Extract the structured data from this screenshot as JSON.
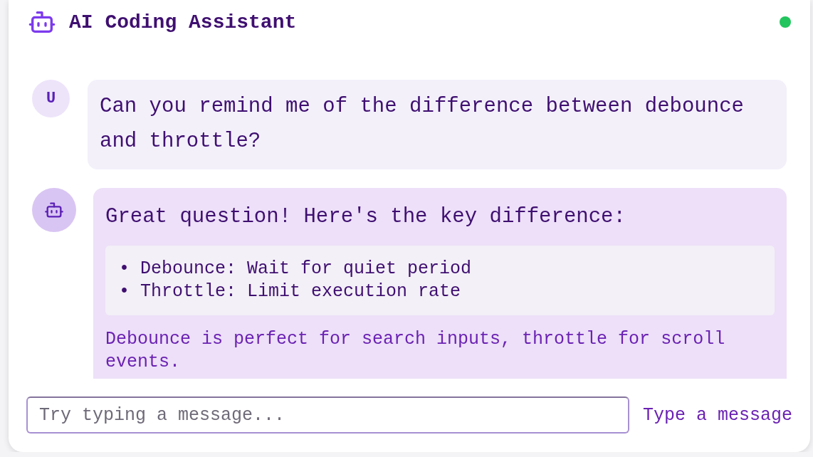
{
  "header": {
    "title": "AI Coding Assistant",
    "online": true
  },
  "messages": [
    {
      "kind": "user",
      "avatar": "U",
      "text": "Can you remind me of the difference between debounce and throttle?"
    },
    {
      "kind": "assistant",
      "text": "Great question! Here's the key difference:",
      "list": [
        "• Debounce: Wait for quiet period",
        "• Throttle: Limit execution rate"
      ],
      "note": "Debounce is perfect for search inputs, throttle for scroll events."
    }
  ],
  "composer": {
    "placeholder": "Try typing a message...",
    "hint": "Type a message"
  }
}
